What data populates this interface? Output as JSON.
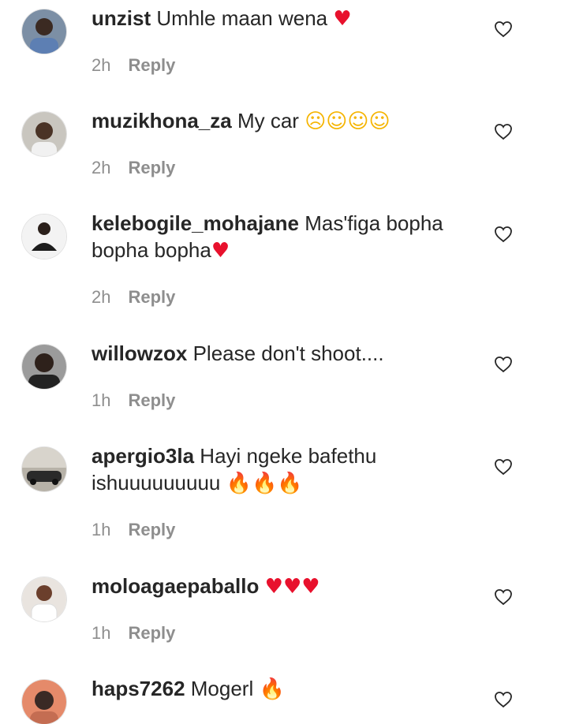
{
  "comments": [
    {
      "username": "unzist",
      "text": "Umhle maan wena",
      "emojis": [
        {
          "glyph": "♥",
          "kind": "red"
        }
      ],
      "time": "2h",
      "reply": "Reply"
    },
    {
      "username": "muzikhona_za",
      "text": "My car",
      "emojis": [
        {
          "glyph": "☹",
          "kind": "face"
        },
        {
          "glyph": "☺",
          "kind": "face"
        },
        {
          "glyph": "☺",
          "kind": "face"
        },
        {
          "glyph": "☺",
          "kind": "face"
        }
      ],
      "time": "2h",
      "reply": "Reply"
    },
    {
      "username": "kelebogile_mohajane",
      "text": "Mas'figa bopha bopha bopha",
      "emojis": [
        {
          "glyph": "♥",
          "kind": "red"
        }
      ],
      "time": "2h",
      "reply": "Reply"
    },
    {
      "username": "willowzox",
      "text": "Please don't shoot....",
      "emojis": [],
      "time": "1h",
      "reply": "Reply"
    },
    {
      "username": "apergio3la",
      "text": "Hayi ngeke bafethu ishuuuuuuuuu",
      "emojis": [
        {
          "glyph": "🔥",
          "kind": "fire"
        },
        {
          "glyph": "🔥",
          "kind": "fire"
        },
        {
          "glyph": "🔥",
          "kind": "fire"
        }
      ],
      "time": "1h",
      "reply": "Reply"
    },
    {
      "username": "moloagaepaballo",
      "text": "",
      "emojis": [
        {
          "glyph": "♥",
          "kind": "red"
        },
        {
          "glyph": "♥",
          "kind": "red"
        },
        {
          "glyph": "♥",
          "kind": "red"
        }
      ],
      "time": "1h",
      "reply": "Reply"
    },
    {
      "username": "haps7262",
      "text": "Mogerl",
      "emojis": [
        {
          "glyph": "🔥",
          "kind": "fire"
        }
      ],
      "time": "",
      "reply": ""
    }
  ],
  "icons": {
    "like": "heart-outline-icon"
  },
  "colors": {
    "text": "#262626",
    "meta": "#8e8e8e",
    "heart_emoji": "#e8112d",
    "fire_emoji": "#f26522"
  }
}
